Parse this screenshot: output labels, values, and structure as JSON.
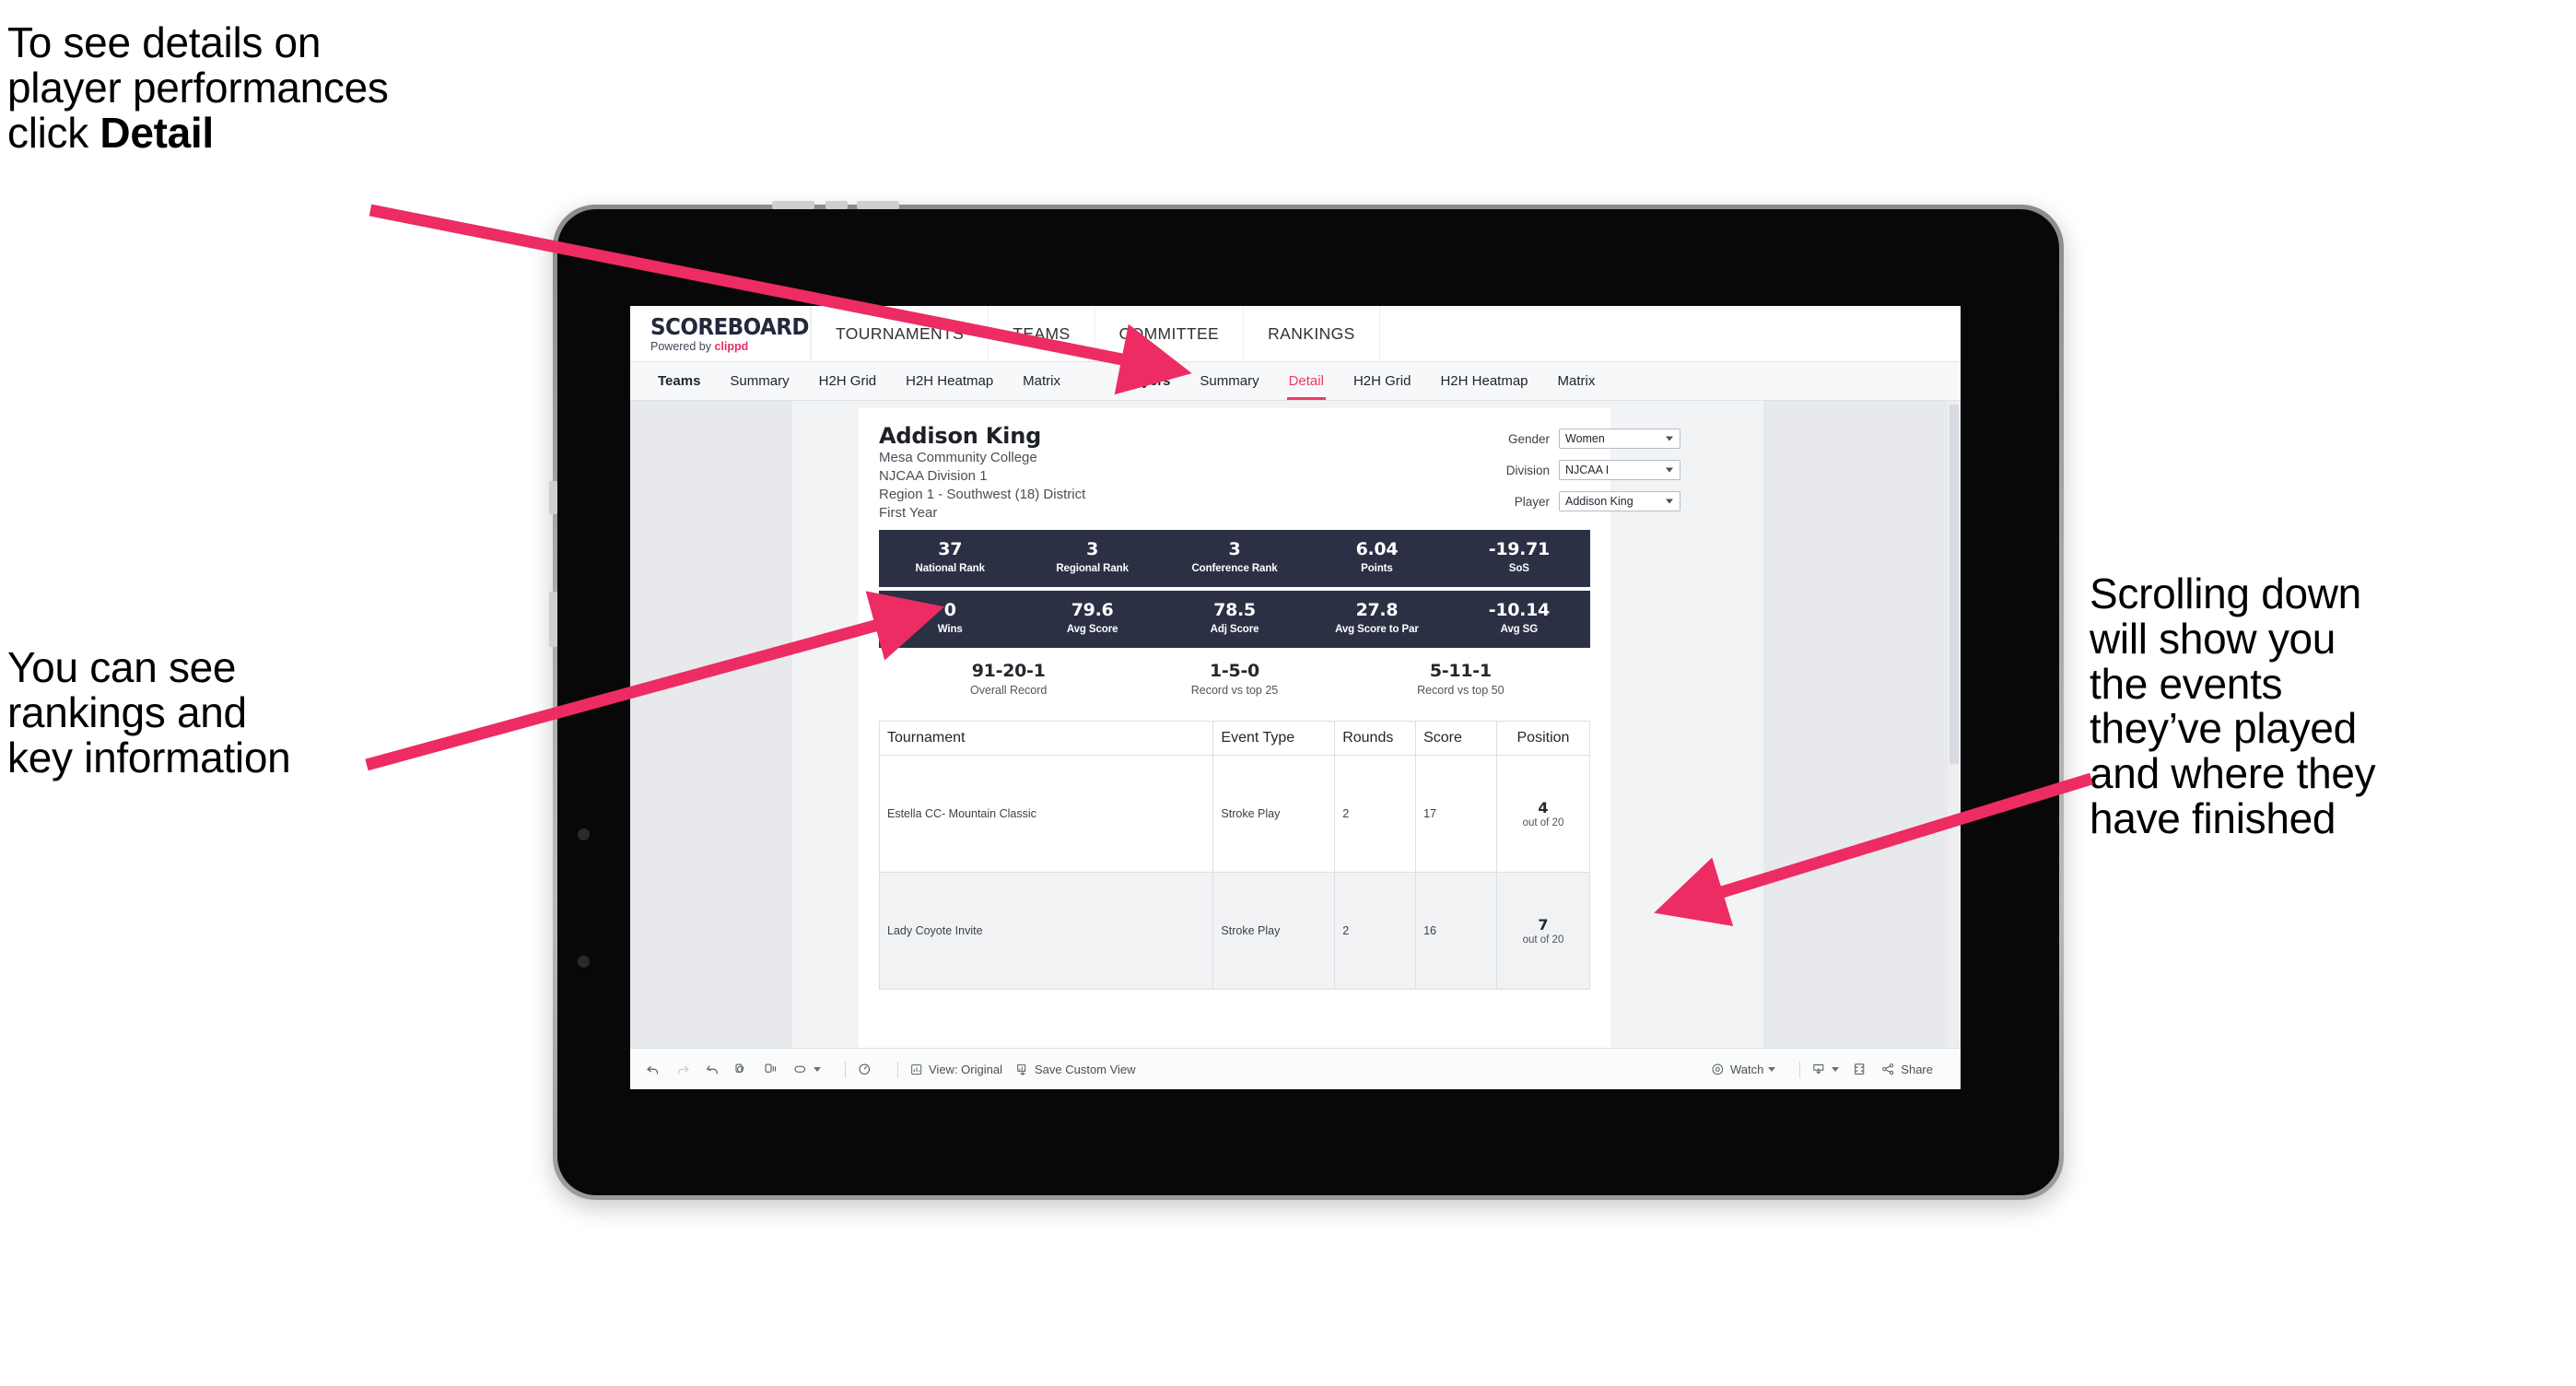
{
  "annotations": {
    "top_left": "To see details on\nplayer performances\nclick ",
    "top_left_bold": "Detail",
    "mid_left": "You can see\nrankings and\nkey information",
    "right": "Scrolling down\nwill show you\nthe events\nthey’ve played\nand where they\nhave finished"
  },
  "accent_color": "#ee3a64",
  "navy_color": "#2b3044",
  "app": {
    "brand": {
      "title": "SCOREBOARD",
      "powered_prefix": "Powered by ",
      "powered_name": "clippd"
    },
    "topnav": [
      "TOURNAMENTS",
      "TEAMS",
      "COMMITTEE",
      "RANKINGS"
    ],
    "tabs_teams": [
      "Teams",
      "Summary",
      "H2H Grid",
      "H2H Heatmap",
      "Matrix"
    ],
    "tabs_players": [
      "Players",
      "Summary",
      "Detail",
      "H2H Grid",
      "H2H Heatmap",
      "Matrix"
    ],
    "active_tab": "Detail"
  },
  "player": {
    "name": "Addison King",
    "school": "Mesa Community College",
    "division": "NJCAA Division 1",
    "region": "Region 1 - Southwest (18) District",
    "year": "First Year"
  },
  "filters": [
    {
      "label": "Gender",
      "value": "Women"
    },
    {
      "label": "Division",
      "value": "NJCAA I"
    },
    {
      "label": "Player",
      "value": "Addison King"
    }
  ],
  "stats_row1": [
    {
      "value": "37",
      "label": "National Rank"
    },
    {
      "value": "3",
      "label": "Regional Rank"
    },
    {
      "value": "3",
      "label": "Conference Rank"
    },
    {
      "value": "6.04",
      "label": "Points"
    },
    {
      "value": "-19.71",
      "label": "SoS"
    }
  ],
  "stats_row2": [
    {
      "value": "0",
      "label": "Wins"
    },
    {
      "value": "79.6",
      "label": "Avg Score"
    },
    {
      "value": "78.5",
      "label": "Adj Score"
    },
    {
      "value": "27.8",
      "label": "Avg Score to Par"
    },
    {
      "value": "-10.14",
      "label": "Avg SG"
    }
  ],
  "records": [
    {
      "value": "91-20-1",
      "label": "Overall Record"
    },
    {
      "value": "1-5-0",
      "label": "Record vs top 25"
    },
    {
      "value": "5-11-1",
      "label": "Record vs top 50"
    }
  ],
  "table": {
    "headers": [
      "Tournament",
      "Event Type",
      "Rounds",
      "Score",
      "Position"
    ],
    "rows": [
      {
        "tournament": "Estella CC- Mountain Classic",
        "event_type": "Stroke Play",
        "rounds": "2",
        "score": "17",
        "position": "4",
        "position_of": "out of 20"
      },
      {
        "tournament": "Lady Coyote Invite",
        "event_type": "Stroke Play",
        "rounds": "2",
        "score": "16",
        "position": "7",
        "position_of": "out of 20"
      }
    ]
  },
  "toolbar": {
    "view_label": "View: Original",
    "save_label": "Save Custom View",
    "watch_label": "Watch",
    "share_label": "Share"
  }
}
